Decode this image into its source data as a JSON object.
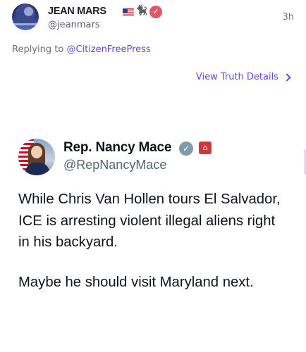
{
  "post": {
    "author_name": "JEAN MARS",
    "author_emoji": "🐈‍⬛",
    "handle": "@jeanmars",
    "timestamp": "3h",
    "reply_prefix": "Replying to",
    "reply_to": "@CitizenFreePress",
    "truth_details_label": "View Truth Details",
    "icons": [
      "flag-icon",
      "black-cat-icon",
      "verified-icon",
      "chevron-right-icon"
    ]
  },
  "embedded_tweet": {
    "name": "Rep. Nancy Mace",
    "handle": "@RepNancyMace",
    "badges": [
      "government-verified-icon",
      "us-house-label-icon"
    ],
    "paragraphs": [
      "While Chris Van Hollen tours El Salvador, ICE is arresting violent illegal aliens right in his backyard.",
      "Maybe he should visit Maryland next."
    ]
  },
  "colors": {
    "link": "#5b4dd6",
    "verified": "#e4546a",
    "text": "#0f1419",
    "muted": "#6b6f7c"
  }
}
